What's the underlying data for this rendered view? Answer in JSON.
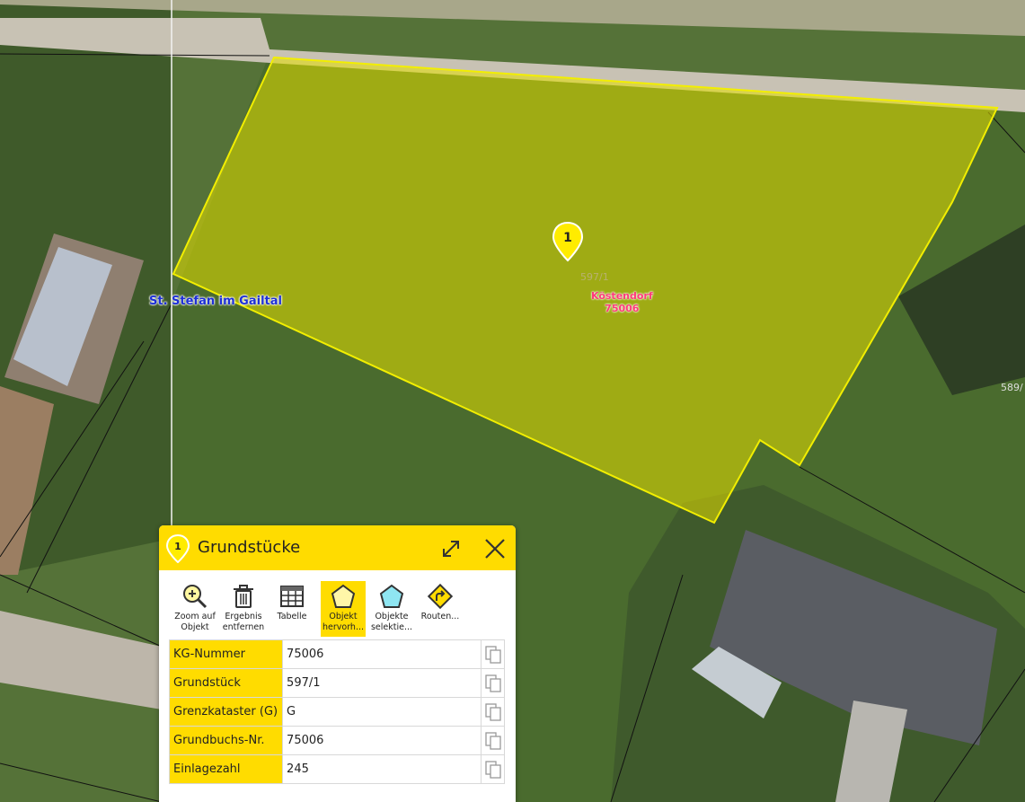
{
  "map": {
    "place_label": "St. Stefan im Gailtal",
    "parcel_label": "597/1",
    "kg_label_name": "Köstendorf",
    "kg_label_number": "75006",
    "edge_parcel_label": "589/",
    "marker_number": "1",
    "highlight_color": "#e6e000"
  },
  "panel": {
    "marker_number": "1",
    "title": "Grundstücke",
    "header_color": "#ffdc00",
    "tools": [
      {
        "label1": "Zoom auf",
        "label2": "Objekt",
        "icon": "zoom-in-icon"
      },
      {
        "label1": "Ergebnis",
        "label2": "entfernen",
        "icon": "trash-icon"
      },
      {
        "label1": "Tabelle",
        "label2": "",
        "icon": "table-icon"
      },
      {
        "label1": "Objekt",
        "label2": "hervorh...",
        "icon": "pentagon-highlight-icon",
        "active": true
      },
      {
        "label1": "Objekte",
        "label2": "selektie...",
        "icon": "pentagon-select-icon"
      },
      {
        "label1": "Routen...",
        "label2": "",
        "icon": "route-sign-icon"
      }
    ],
    "attributes": [
      {
        "key": "KG-Nummer",
        "value": "75006"
      },
      {
        "key": "Grundstück",
        "value": "597/1"
      },
      {
        "key": "Grenzkataster (G)",
        "value": "G"
      },
      {
        "key": "Grundbuchs-Nr.",
        "value": "75006"
      },
      {
        "key": "Einlagezahl",
        "value": "245"
      }
    ]
  }
}
